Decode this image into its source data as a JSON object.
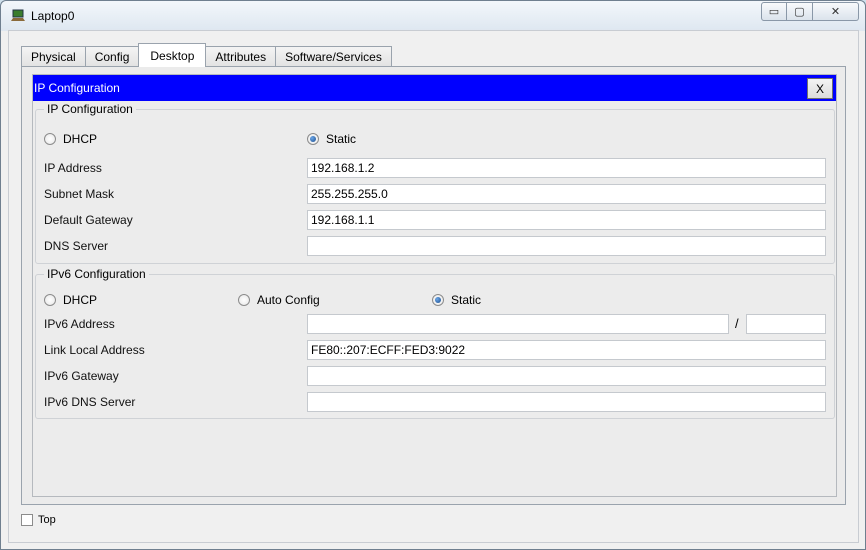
{
  "window": {
    "title": "Laptop0",
    "controls": {
      "minimize": "▭",
      "maximize": "▢",
      "close": "✕"
    }
  },
  "tabs": [
    {
      "label": "Physical",
      "active": false
    },
    {
      "label": "Config",
      "active": false
    },
    {
      "label": "Desktop",
      "active": true
    },
    {
      "label": "Attributes",
      "active": false
    },
    {
      "label": "Software/Services",
      "active": false
    }
  ],
  "dialog": {
    "title": "IP Configuration",
    "close_label": "X",
    "header_color": "#0000ff"
  },
  "ipv4": {
    "legend": "IP Configuration",
    "dhcp_label": "DHCP",
    "static_label": "Static",
    "selected": "Static",
    "ip_address_label": "IP Address",
    "ip_address_value": "192.168.1.2",
    "subnet_mask_label": "Subnet Mask",
    "subnet_mask_value": "255.255.255.0",
    "default_gateway_label": "Default Gateway",
    "default_gateway_value": "192.168.1.1",
    "dns_server_label": "DNS Server",
    "dns_server_value": ""
  },
  "ipv6": {
    "legend": "IPv6 Configuration",
    "dhcp_label": "DHCP",
    "auto_config_label": "Auto Config",
    "static_label": "Static",
    "selected": "Static",
    "ipv6_address_label": "IPv6 Address",
    "ipv6_address_value": "",
    "prefix_separator": "/",
    "prefix_value": "",
    "link_local_label": "Link Local Address",
    "link_local_value": "FE80::207:ECFF:FED3:9022",
    "gateway_label": "IPv6 Gateway",
    "gateway_value": "",
    "dns_label": "IPv6 DNS Server",
    "dns_value": ""
  },
  "footer": {
    "top_label": "Top",
    "top_checked": false
  }
}
